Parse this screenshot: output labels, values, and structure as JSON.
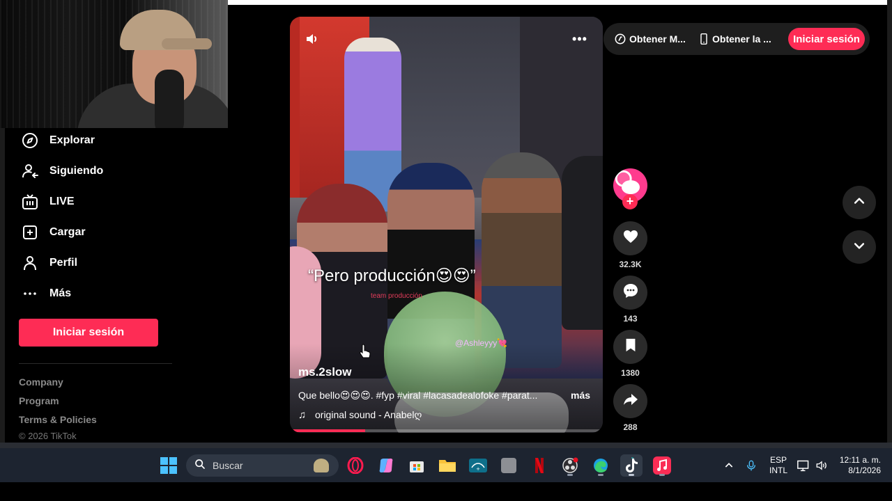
{
  "sidebar": {
    "items": [
      {
        "label": "Explorar",
        "icon": "compass-icon"
      },
      {
        "label": "Siguiendo",
        "icon": "following-icon"
      },
      {
        "label": "LIVE",
        "icon": "live-tv-icon"
      },
      {
        "label": "Cargar",
        "icon": "upload-plus-icon"
      },
      {
        "label": "Perfil",
        "icon": "profile-icon"
      },
      {
        "label": "Más",
        "icon": "more-dots-icon"
      }
    ],
    "login_label": "Iniciar sesión",
    "footer_links": [
      "Company",
      "Program",
      "Terms & Policies"
    ],
    "copyright": "© 2026 TikTok"
  },
  "header": {
    "get_coins_label": "Obtener M...",
    "get_app_label": "Obtener la ...",
    "login_label": "Iniciar sesión"
  },
  "video": {
    "overlay_caption": "“Pero producción😍😍”",
    "overlay_small_text": "team producción",
    "overlay_handle": "@Ashleyyy💘",
    "author": "ms.2slow",
    "description": "Que bello😍😍😍. #fyp #viral #lacasadealofoke #parat...",
    "more_label": "más",
    "music": "original sound - Anabelღ",
    "progress": 0.24
  },
  "actions": {
    "likes": "32.3K",
    "comments": "143",
    "saves": "1380",
    "shares": "288"
  },
  "taskbar": {
    "search_placeholder": "Buscar",
    "apps": [
      "opera-icon",
      "copilot-icon",
      "microsoft-store-icon",
      "file-explorer-icon",
      "disney-plus-icon",
      "app-icon",
      "netflix-icon",
      "obs-icon",
      "edge-icon",
      "tiktok-icon",
      "apple-music-icon"
    ],
    "language": "ESP",
    "keyboard": "INTL",
    "time": "12:11 a. m.",
    "date": "8/1/2026"
  },
  "colors": {
    "accent": "#fe2c55",
    "background": "#000000",
    "taskbar": "#1d2430"
  }
}
